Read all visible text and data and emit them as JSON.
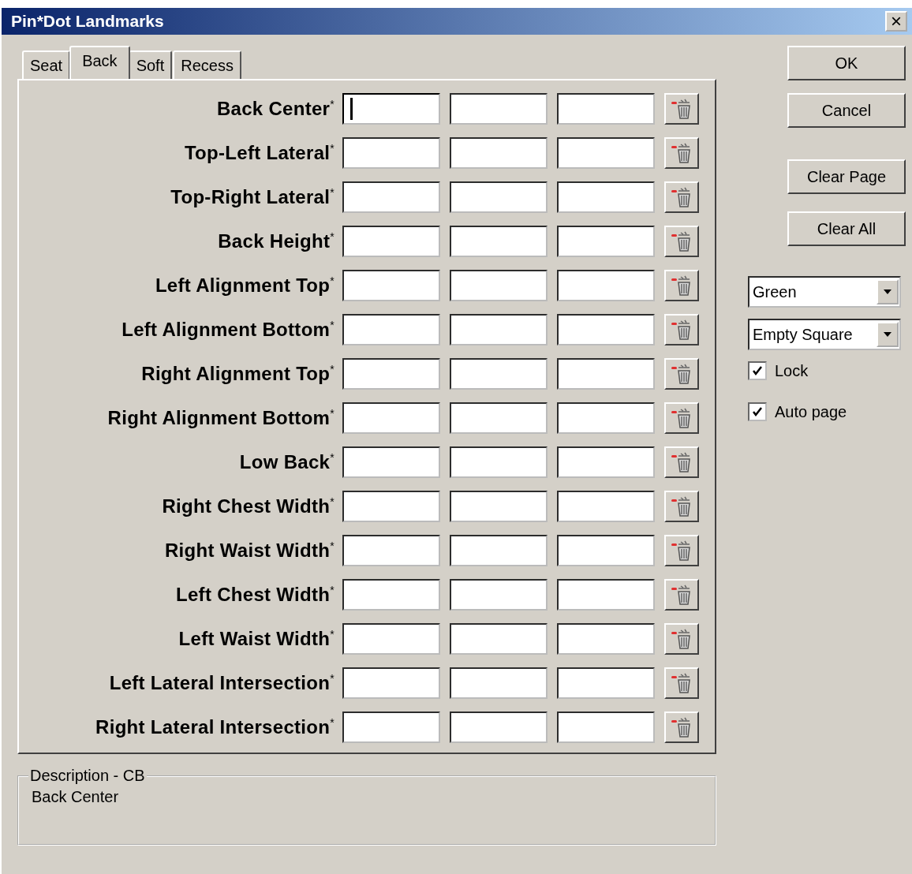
{
  "window": {
    "title": "Pin*Dot Landmarks",
    "close": "×"
  },
  "tabs": [
    {
      "label": "Seat",
      "selected": false
    },
    {
      "label": "Back",
      "selected": true
    },
    {
      "label": "Soft",
      "selected": false
    },
    {
      "label": "Recess",
      "selected": false
    }
  ],
  "landmarks": [
    {
      "label": "Back Center$^{*}$",
      "fields": [
        {
          "focused": true
        },
        {
          "focused": false
        },
        {
          "focused": false
        }
      ]
    },
    {
      "label": "Top-Left Lateral$^{*}$",
      "fields": [
        {
          "focused": false
        },
        {
          "focused": false
        },
        {
          "focused": false
        }
      ]
    },
    {
      "label": "Top-Right Lateral$^{*}$",
      "fields": [
        {
          "focused": false
        },
        {
          "focused": false
        },
        {
          "focused": false
        }
      ]
    },
    {
      "label": "Back Height$^{*}$",
      "fields": [
        {
          "focused": false
        },
        {
          "focused": false
        },
        {
          "focused": false
        }
      ]
    },
    {
      "label": "Left Alignment Top$^{*}$",
      "fields": [
        {
          "focused": false
        },
        {
          "focused": false
        },
        {
          "focused": false
        }
      ]
    },
    {
      "label": "Left Alignment Bottom$^{*}$",
      "fields": [
        {
          "focused": false
        },
        {
          "focused": false
        },
        {
          "focused": false
        }
      ]
    },
    {
      "label": "Right Alignment Top$^{*}$",
      "fields": [
        {
          "focused": false
        },
        {
          "focused": false
        },
        {
          "focused": false
        }
      ]
    },
    {
      "label": "Right Alignment Bottom$^{*}$",
      "fields": [
        {
          "focused": false
        },
        {
          "focused": false
        },
        {
          "focused": false
        }
      ]
    },
    {
      "label": "Low Back$^{*}$",
      "fields": [
        {
          "focused": false
        },
        {
          "focused": false
        },
        {
          "focused": false
        }
      ]
    },
    {
      "label": "Right Chest Width$^{*}$",
      "fields": [
        {
          "focused": false
        },
        {
          "focused": false
        },
        {
          "focused": false
        }
      ]
    },
    {
      "label": "Right Waist Width$^{*}$",
      "fields": [
        {
          "focused": false
        },
        {
          "focused": false
        },
        {
          "focused": false
        }
      ]
    },
    {
      "label": "Left Chest Width$^{*}$",
      "fields": [
        {
          "focused": false
        },
        {
          "focused": false
        },
        {
          "focused": false
        }
      ]
    },
    {
      "label": "Left Waist Width$^{*}$",
      "fields": [
        {
          "focused": false
        },
        {
          "focused": false
        },
        {
          "focused": false
        }
      ]
    },
    {
      "label": "Left Lateral Intersection$^{*}$",
      "fields": [
        {
          "focused": false
        },
        {
          "focused": false
        },
        {
          "focused": false
        }
      ]
    },
    {
      "label": "Right Lateral Intersection$^{*}$",
      "fields": [
        {
          "focused": false
        },
        {
          "focused": false
        },
        {
          "focused": false
        }
      ]
    }
  ],
  "description": {
    "legend": "Description - CB",
    "text": "Back Center"
  },
  "buttons": [
    {
      "label": "OK"
    },
    {
      "label": "Cancel"
    },
    {
      "label": "Clear Page"
    },
    {
      "label": "Clear All"
    }
  ],
  "dropdowns": [
    {
      "value": "Green"
    },
    {
      "value": "Empty Square"
    }
  ],
  "checkboxes": [
    {
      "label": "Lock",
      "checked": true
    },
    {
      "label": "Auto page",
      "checked": true
    }
  ]
}
